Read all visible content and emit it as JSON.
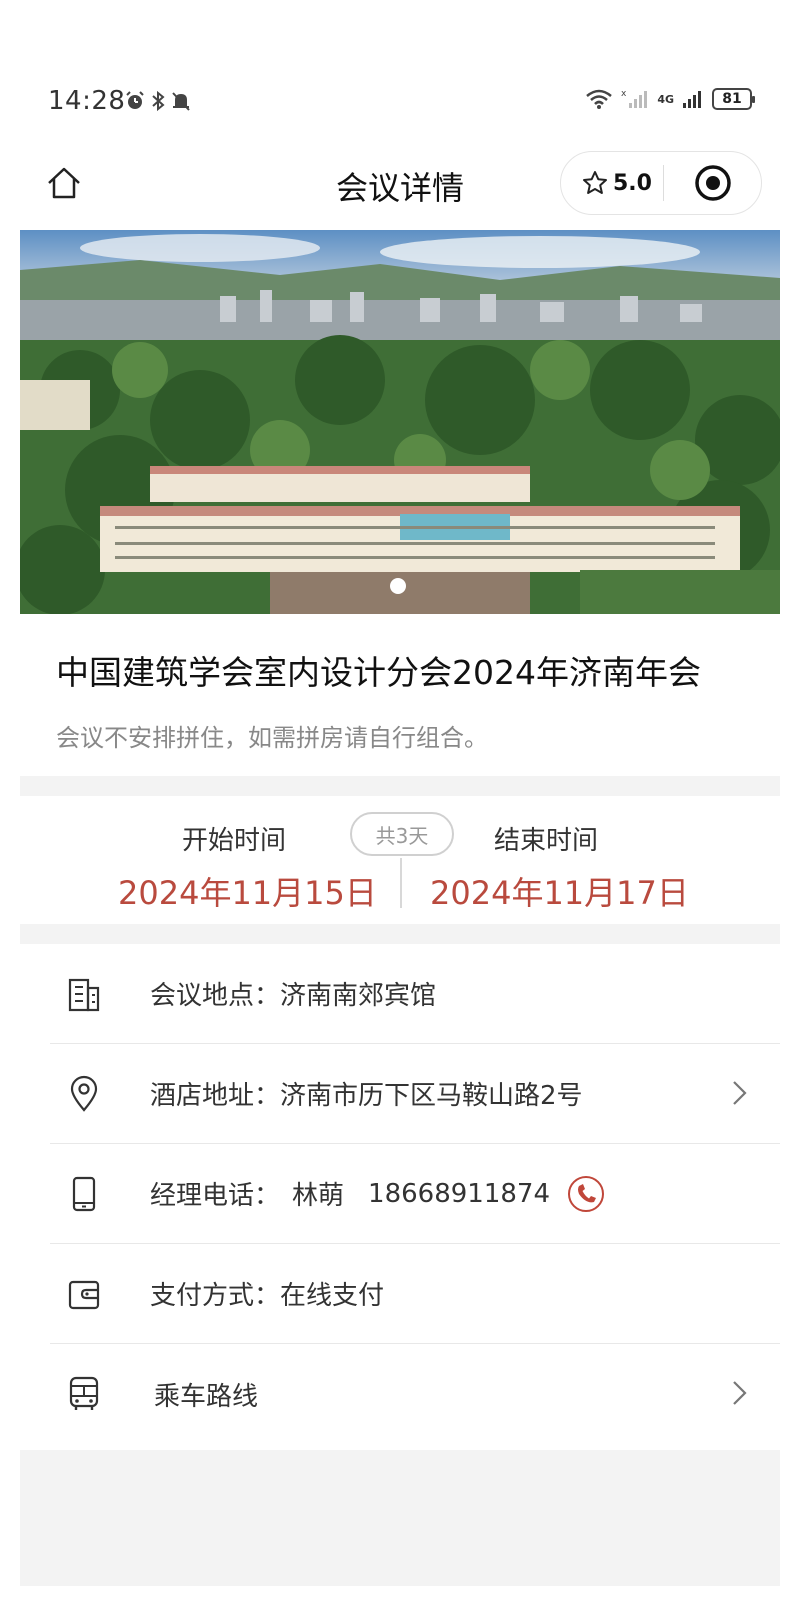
{
  "status_bar": {
    "time": "14:28",
    "battery": "81",
    "network": "4G"
  },
  "nav": {
    "title": "会议详情",
    "rating": "5.0"
  },
  "conference": {
    "title": "中国建筑学会室内设计分会2024年济南年会",
    "note": "会议不安排拼住，如需拼房请自行组合。"
  },
  "dates": {
    "start_label": "开始时间",
    "start_value": "2024年11月15日",
    "end_label": "结束时间",
    "end_value": "2024年11月17日",
    "duration": "共3天"
  },
  "info": {
    "venue": "会议地点：济南南郊宾馆",
    "address": "酒店地址：济南市历下区马鞍山路2号",
    "manager_label": "经理电话：",
    "manager_name": "林萌",
    "manager_phone": "18668911874",
    "payment": "支付方式：在线支付",
    "route": "乘车路线"
  },
  "colors": {
    "accent": "#b94a3e",
    "divider": "#e8e8e8",
    "section_gap": "#f3f3f3"
  }
}
